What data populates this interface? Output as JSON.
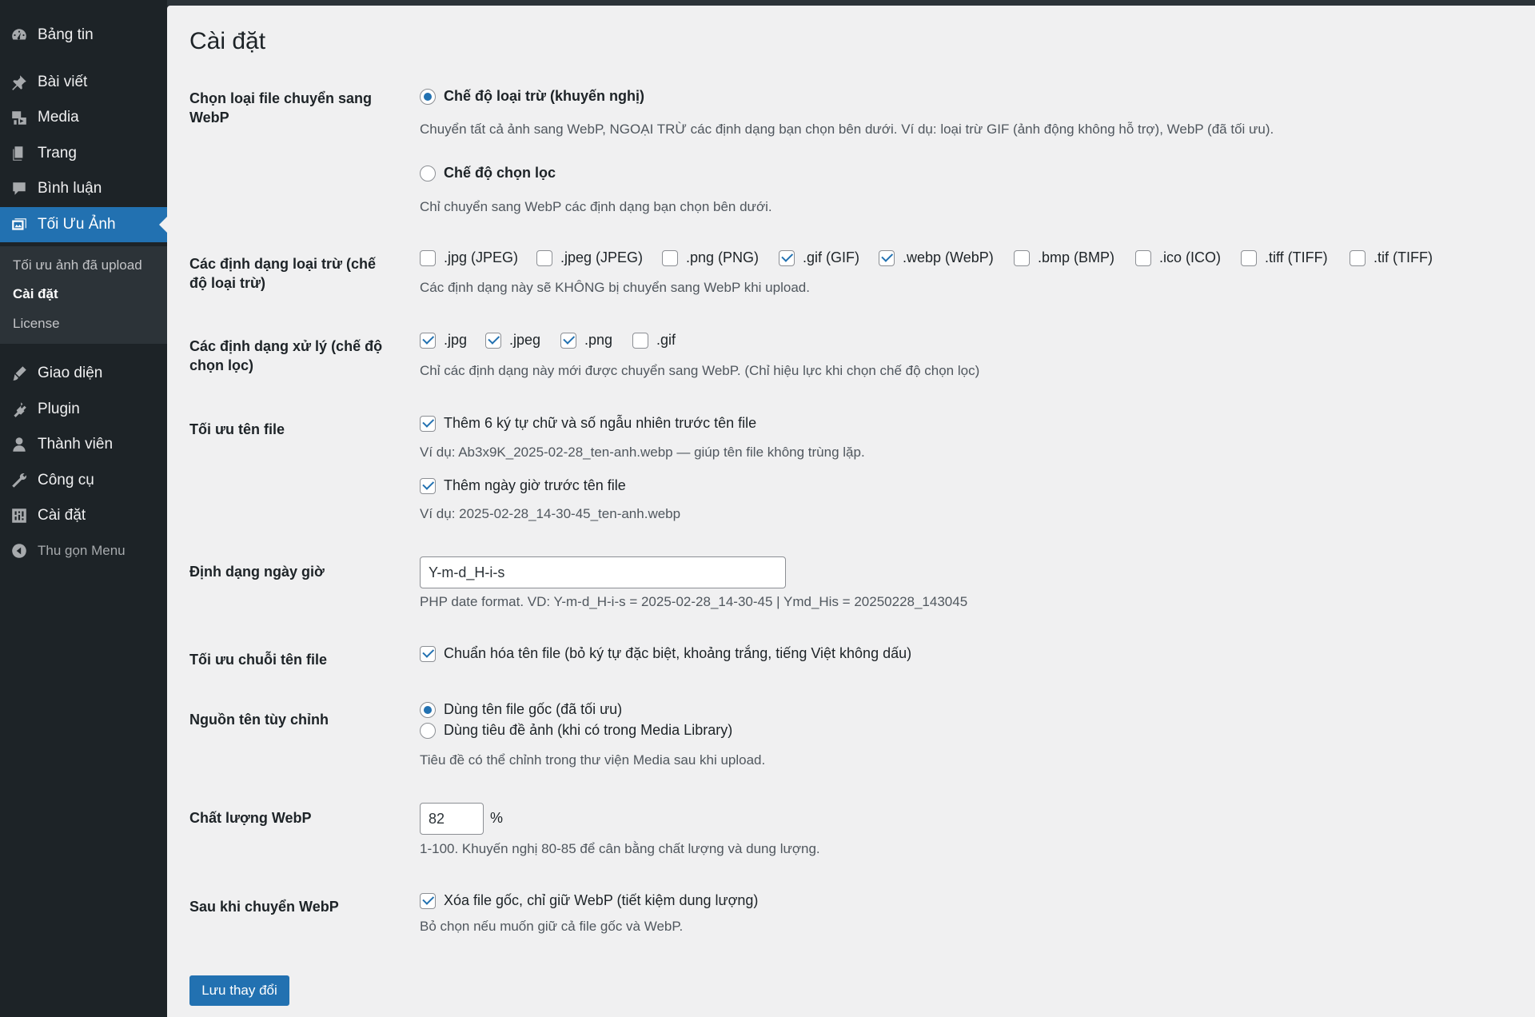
{
  "sidebar": {
    "items": [
      {
        "label": "Bảng tin",
        "icon": "dashboard-icon"
      },
      {
        "label": "Bài viết",
        "icon": "pin-icon"
      },
      {
        "label": "Media",
        "icon": "media-icon"
      },
      {
        "label": "Trang",
        "icon": "page-icon"
      },
      {
        "label": "Bình luận",
        "icon": "comment-icon"
      },
      {
        "label": "Tối Ưu Ảnh",
        "icon": "images-icon",
        "active": true
      },
      {
        "label": "Giao diện",
        "icon": "brush-icon"
      },
      {
        "label": "Plugin",
        "icon": "plugin-icon"
      },
      {
        "label": "Thành viên",
        "icon": "user-icon"
      },
      {
        "label": "Công cụ",
        "icon": "wrench-icon"
      },
      {
        "label": "Cài đặt",
        "icon": "settings-icon"
      }
    ],
    "submenu": [
      "Tối ưu ảnh đã upload",
      "Cài đặt",
      "License"
    ],
    "collapse_label": "Thu gọn Menu"
  },
  "page": {
    "title": "Cài đặt",
    "mode": {
      "label": "Chọn loại file chuyển sang WebP",
      "exclude_label": "Chế độ loại trừ (khuyến nghị)",
      "exclude_desc": "Chuyển tất cả ảnh sang WebP, NGOẠI TRỪ các định dạng bạn chọn bên dưới. Ví dụ: loại trừ GIF (ảnh động không hỗ trợ), WebP (đã tối ưu).",
      "select_label": "Chế độ chọn lọc",
      "select_desc": "Chỉ chuyển sang WebP các định dạng bạn chọn bên dưới."
    },
    "exclude_formats": {
      "label": "Các định dạng loại trừ (chế độ loại trừ)",
      "options": [
        {
          "label": ".jpg (JPEG)",
          "checked": false
        },
        {
          "label": ".jpeg (JPEG)",
          "checked": false
        },
        {
          "label": ".png (PNG)",
          "checked": false
        },
        {
          "label": ".gif (GIF)",
          "checked": true
        },
        {
          "label": ".webp (WebP)",
          "checked": true
        },
        {
          "label": ".bmp (BMP)",
          "checked": false
        },
        {
          "label": ".ico (ICO)",
          "checked": false
        },
        {
          "label": ".tiff (TIFF)",
          "checked": false
        },
        {
          "label": ".tif (TIFF)",
          "checked": false
        }
      ],
      "desc": "Các định dạng này sẽ KHÔNG bị chuyển sang WebP khi upload."
    },
    "include_formats": {
      "label": "Các định dạng xử lý (chế độ chọn lọc)",
      "options": [
        {
          "label": ".jpg",
          "checked": true
        },
        {
          "label": ".jpeg",
          "checked": true
        },
        {
          "label": ".png",
          "checked": true
        },
        {
          "label": ".gif",
          "checked": false
        }
      ],
      "desc": "Chỉ các định dạng này mới được chuyển sang WebP. (Chỉ hiệu lực khi chọn chế độ chọn lọc)"
    },
    "filename": {
      "label": "Tối ưu tên file",
      "random_label": "Thêm 6 ký tự chữ và số ngẫu nhiên trước tên file",
      "random_desc": "Ví dụ: Ab3x9K_2025-02-28_ten-anh.webp — giúp tên file không trùng lặp.",
      "date_label": "Thêm ngày giờ trước tên file",
      "date_desc": "Ví dụ: 2025-02-28_14-30-45_ten-anh.webp"
    },
    "date_format": {
      "label": "Định dạng ngày giờ",
      "value": "Y-m-d_H-i-s",
      "desc": "PHP date format. VD: Y-m-d_H-i-s = 2025-02-28_14-30-45 | Ymd_His = 20250228_143045"
    },
    "sanitize": {
      "label": "Tối ưu chuỗi tên file",
      "option": "Chuẩn hóa tên file (bỏ ký tự đặc biệt, khoảng trắng, tiếng Việt không dấu)"
    },
    "name_source": {
      "label": "Nguồn tên tùy chỉnh",
      "opt1": "Dùng tên file gốc (đã tối ưu)",
      "opt2": "Dùng tiêu đề ảnh (khi có trong Media Library)",
      "desc": "Tiêu đề có thể chỉnh trong thư viện Media sau khi upload."
    },
    "quality": {
      "label": "Chất lượng WebP",
      "value": "82",
      "unit": "%",
      "desc": "1-100. Khuyến nghị 80-85 để cân bằng chất lượng và dung lượng."
    },
    "after": {
      "label": "Sau khi chuyển WebP",
      "option": "Xóa file gốc, chỉ giữ WebP (tiết kiệm dung lượng)",
      "desc": "Bỏ chọn nếu muốn giữ cả file gốc và WebP."
    },
    "save_label": "Lưu thay đổi"
  },
  "colors": {
    "sidebar_bg": "#1d2327",
    "accent": "#2271b1",
    "main_bg": "#f0f0f1"
  }
}
